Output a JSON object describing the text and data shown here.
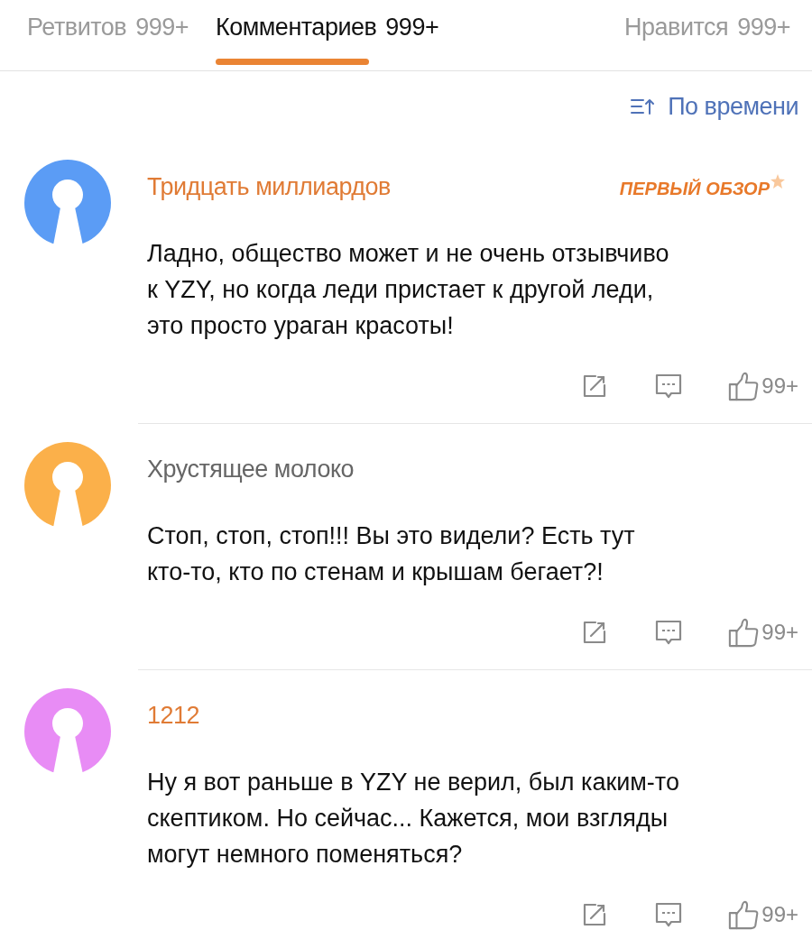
{
  "tabs": [
    {
      "label": "Ретвитов",
      "count": "999+",
      "selected": false
    },
    {
      "label": "Комментариев",
      "count": "999+",
      "selected": true
    },
    {
      "label": "Нравится",
      "count": "999+",
      "selected": false
    }
  ],
  "sort": {
    "label": "По времени"
  },
  "comments": [
    {
      "author": "Тридцать миллиардов",
      "author_highlighted": true,
      "color": "#5b9cf5",
      "badge": "ПЕРВЫЙ ОБЗОР",
      "text": "Ладно, общество может и не очень отзывчиво\nк YZY, но когда леди пристает к другой леди,\nэто просто ураган красоты!",
      "likes": "99+"
    },
    {
      "author": "Хрустящее молоко",
      "author_highlighted": false,
      "color": "#fbb04a",
      "text": "Стоп, стоп, стоп!!! Вы это видели? Есть тут\nкто-то, кто по стенам и крышам бегает?!",
      "likes": "99+"
    },
    {
      "author": "1212",
      "author_highlighted": true,
      "color": "#e88cf5",
      "text": "Ну я вот раньше в YZY не верил, был каким-то\nскептиком. Но сейчас... Кажется, мои взгляды\nмогут немного поменяться?",
      "likes": "99+"
    }
  ]
}
